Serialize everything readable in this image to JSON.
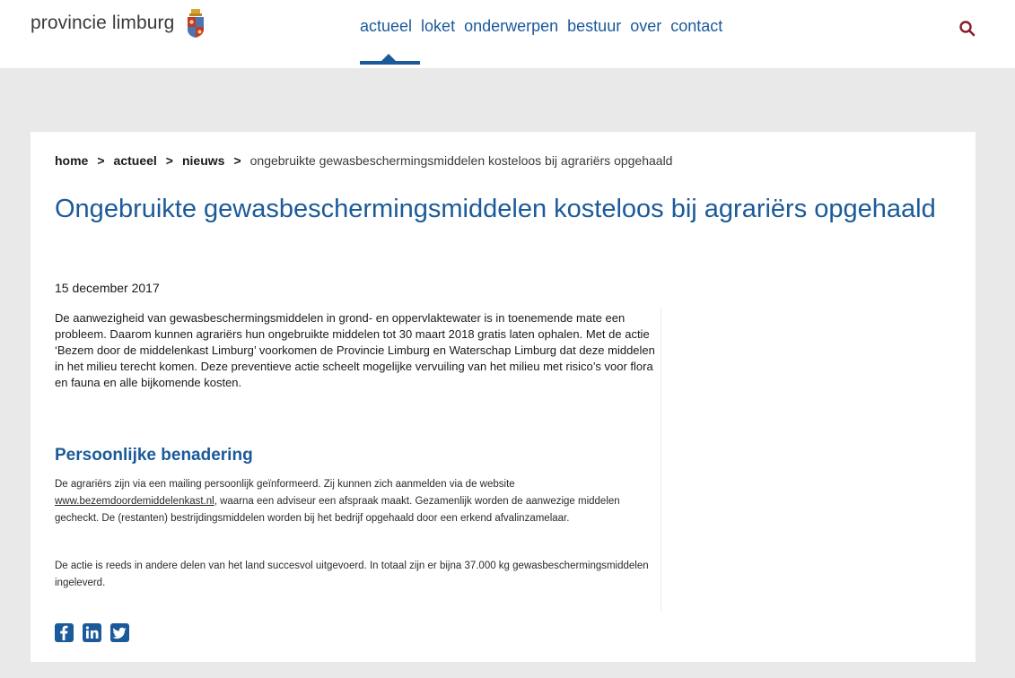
{
  "header": {
    "logo_text": "provincie limburg",
    "nav": [
      "actueel",
      "loket",
      "onderwerpen",
      "bestuur",
      "over",
      "contact"
    ],
    "active_nav": "actueel"
  },
  "breadcrumb": {
    "items": [
      "home",
      "actueel",
      "nieuws"
    ],
    "separator": ">",
    "current": "ongebruikte gewasbeschermingsmiddelen kosteloos bij agrariërs opgehaald"
  },
  "article": {
    "title": "Ongebruikte gewasbeschermingsmiddelen kosteloos bij agrariërs opgehaald",
    "date": "15 december 2017",
    "intro": "De aanwezigheid van gewasbeschermingsmiddelen in grond- en oppervlaktewater is in toenemende mate een probleem. Daarom kunnen agrariërs hun ongebruikte middelen tot 30 maart 2018 gratis laten ophalen. Met de actie ‘Bezem door de middelenkast Limburg’ voorkomen de Provincie Limburg en Waterschap Limburg dat deze middelen in het milieu terecht komen. Deze preventieve actie scheelt mogelijke vervuiling van het milieu met risico’s voor flora en fauna en alle bijkomende kosten.",
    "subheading": "Persoonlijke benadering",
    "para1_before": "De agrariërs zijn via een mailing persoonlijk geïnformeerd. Zij kunnen zich aanmelden via de website ",
    "para1_link": "www.bezemdoordemiddelenkast.nl",
    "para1_after": ", waarna een adviseur een afspraak maakt. Gezamenlijk worden de aanwezige middelen gecheckt. De (restanten) bestrijdingsmiddelen worden bij het bedrijf opgehaald door een erkend afvalinzamelaar.",
    "para2": "De actie is reeds in andere delen van het land succesvol uitgevoerd. In totaal zijn er bijna 37.000 kg gewasbeschermingsmiddelen ingeleverd."
  },
  "social": [
    "facebook-icon",
    "linkedin-icon",
    "twitter-icon"
  ],
  "colors": {
    "brand_blue": "#1b5a9a",
    "background": "#e9e9e9"
  }
}
